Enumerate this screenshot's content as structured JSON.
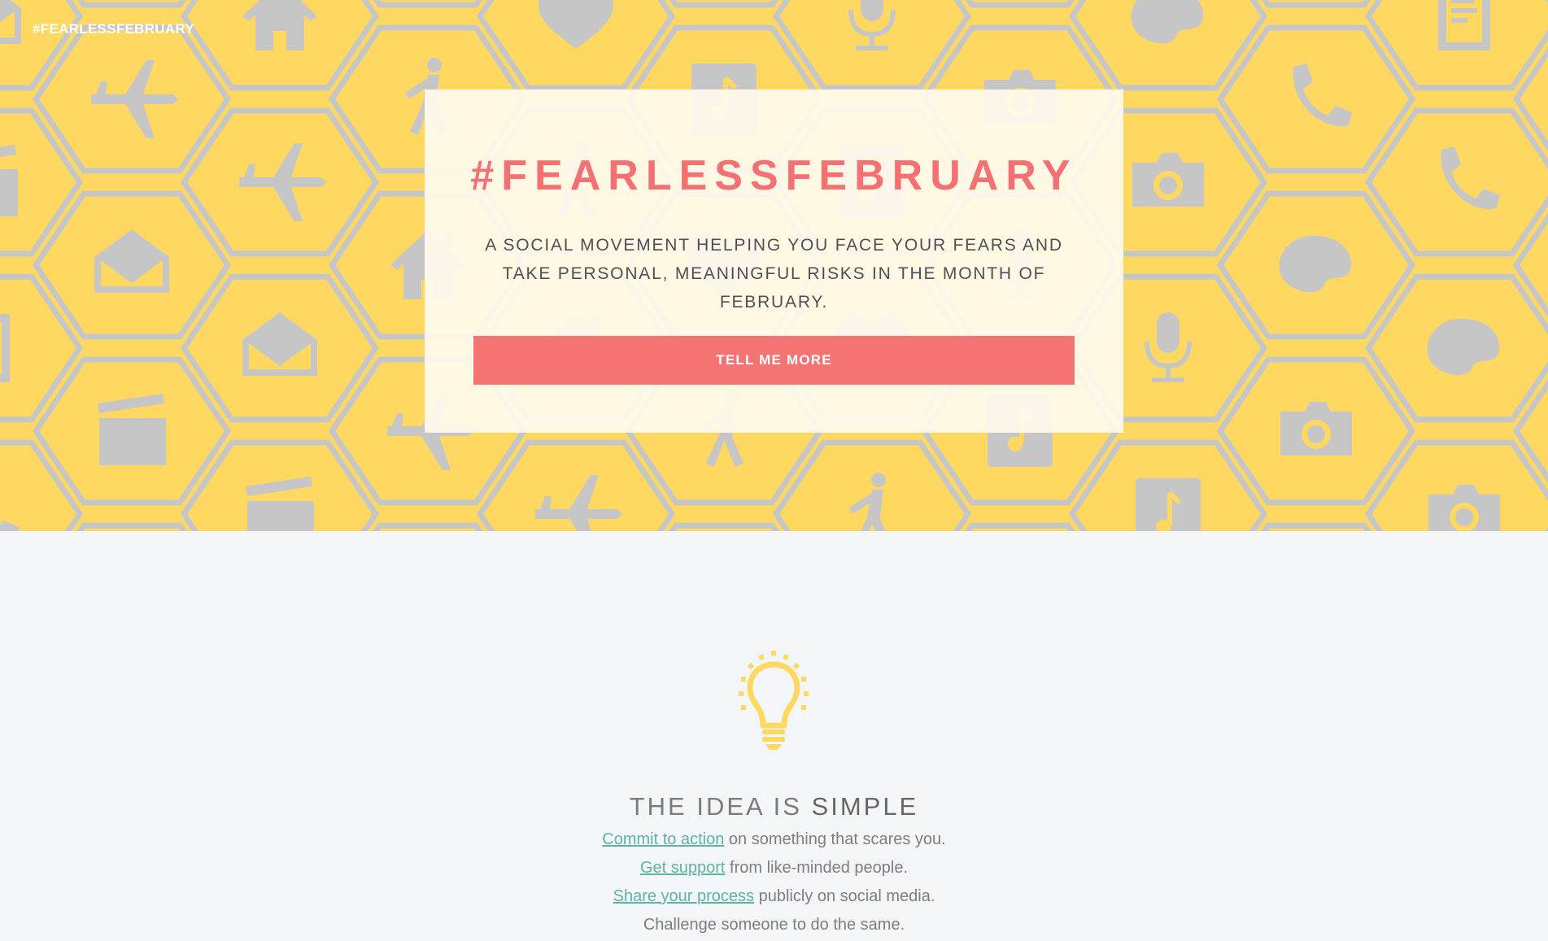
{
  "hero": {
    "brand": "#FEARLESSFEBRUARY",
    "title": "#FEARLESSFEBRUARY",
    "subtitle": "A SOCIAL MOVEMENT HELPING YOU FACE YOUR FEARS AND TAKE PERSONAL, MEANINGFUL RISKS IN THE MONTH OF FEBRUARY.",
    "cta_label": "TELL ME MORE",
    "background_icons": [
      "airplane-icon",
      "palette-icon",
      "walking-person-icon",
      "document-icon",
      "music-note-icon",
      "envelope-icon",
      "camera-icon",
      "home-icon",
      "phone-icon",
      "heart-icon",
      "clapperboard-icon",
      "microphone-icon"
    ]
  },
  "idea": {
    "icon": "lightbulb-icon",
    "title_light": "THE IDEA IS",
    "title_strong": "SIMPLE",
    "lines": [
      {
        "link": "Commit to action",
        "rest": "on something that scares you."
      },
      {
        "link": "Get support",
        "rest": "from like-minded people."
      },
      {
        "link": "Share your process",
        "rest": "publicly on social media."
      },
      {
        "link": "",
        "rest": "Challenge someone to do the same."
      }
    ]
  },
  "colors": {
    "hero_yellow": "#ffd862",
    "hex_grey": "#c6c6c6",
    "accent_coral": "#f47373",
    "link_teal": "#5fb3a1",
    "page_bg": "#f3f6f9"
  }
}
